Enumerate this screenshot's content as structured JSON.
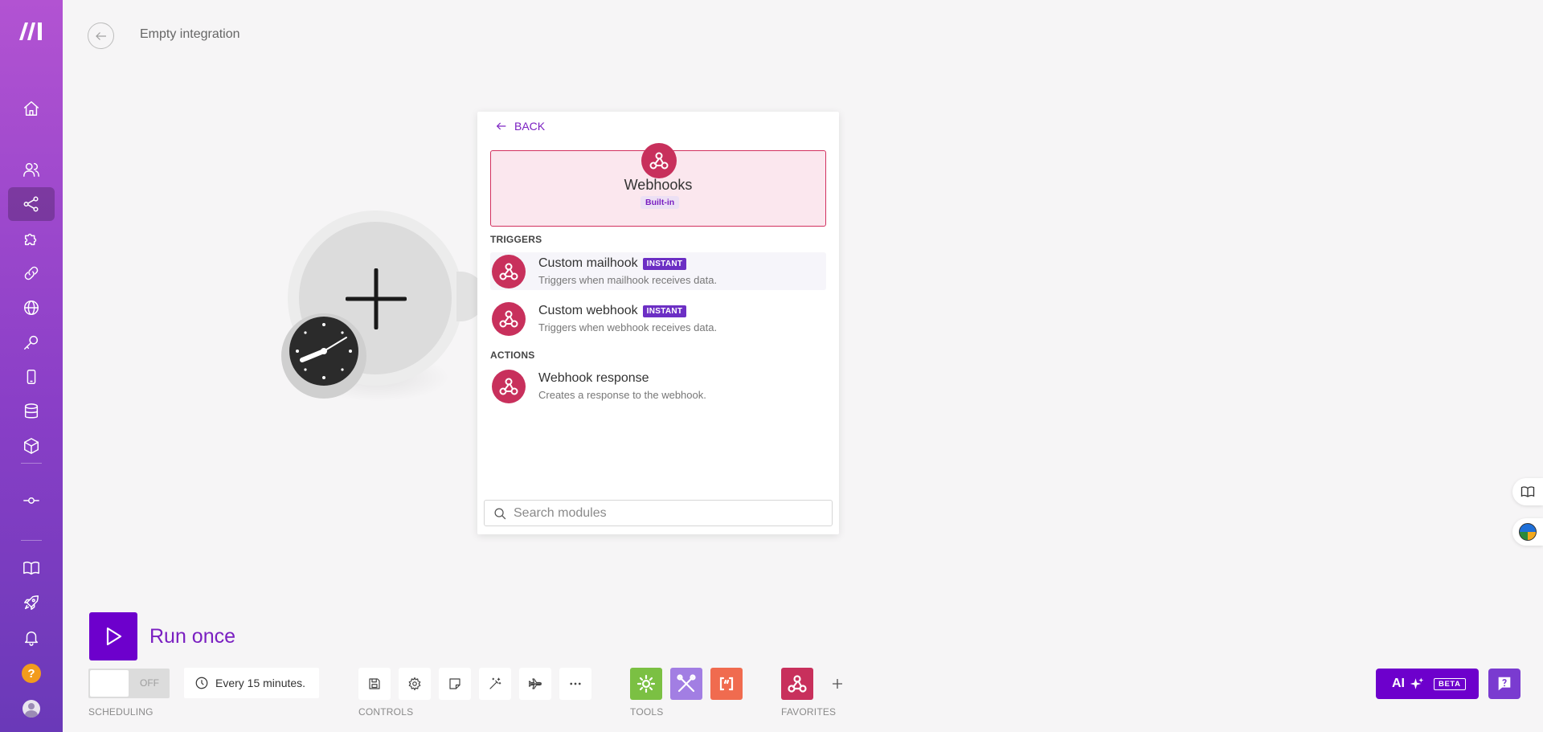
{
  "header": {
    "title": "Empty integration"
  },
  "panel": {
    "back_label": "BACK",
    "app": {
      "name": "Webhooks",
      "badge": "Built-in"
    },
    "triggers_label": "TRIGGERS",
    "triggers": [
      {
        "title": "Custom mailhook",
        "badge": "INSTANT",
        "desc": "Triggers when mailhook receives data."
      },
      {
        "title": "Custom webhook",
        "badge": "INSTANT",
        "desc": "Triggers when webhook receives data."
      }
    ],
    "actions_label": "ACTIONS",
    "actions": [
      {
        "title": "Webhook response",
        "desc": "Creates a response to the webhook."
      }
    ],
    "search": {
      "placeholder": "Search modules",
      "value": ""
    }
  },
  "toolbar": {
    "run_label": "Run once",
    "toggle_label": "OFF",
    "schedule_text": "Every 15 minutes.",
    "scheduling_label": "SCHEDULING",
    "controls_label": "CONTROLS",
    "tools_label": "TOOLS",
    "favorites_label": "FAVORITES",
    "ai_label": "AI",
    "ai_badge": "BETA"
  },
  "colors": {
    "brand": "#6d00cc",
    "webhook": "#c8305c",
    "tool_green": "#7bc043",
    "tool_purple": "#a27ee3",
    "tool_orange": "#f06b4f"
  }
}
